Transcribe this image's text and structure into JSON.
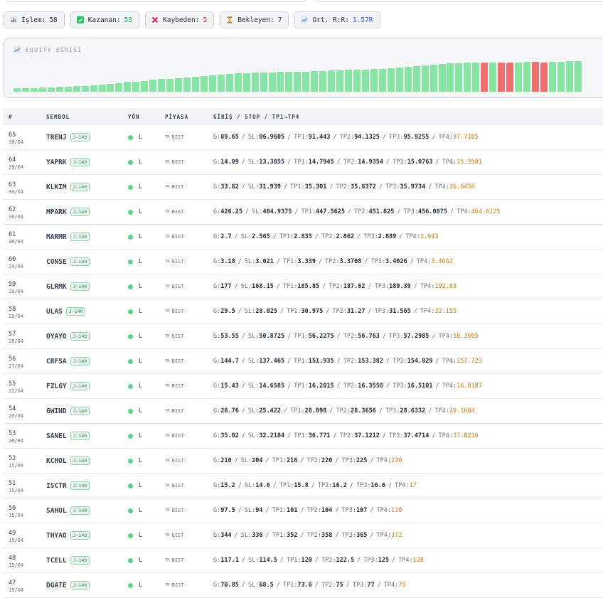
{
  "stats": {
    "islem": {
      "label": "İşlem:",
      "value": "58"
    },
    "kazanan": {
      "label": "Kazanan:",
      "value": "53",
      "color": "#16a34a"
    },
    "kaybeden": {
      "label": "Kaybeden:",
      "value": "5",
      "color": "#dc2626"
    },
    "bekleyen": {
      "label": "Bekleyen:",
      "value": "7"
    },
    "rr": {
      "label": "Ort. R:R:",
      "value": "1.57R",
      "color": "#2563eb"
    }
  },
  "equity": {
    "title": "EQUITY EĞRİSİ",
    "win_color": "#86e5a3",
    "loss_color": "#f07070",
    "bars": [
      {
        "level": 0.1,
        "result": "win"
      },
      {
        "level": 0.11,
        "result": "win"
      },
      {
        "level": 0.12,
        "result": "win"
      },
      {
        "level": 0.13,
        "result": "win"
      },
      {
        "level": 0.14,
        "result": "win"
      },
      {
        "level": 0.15,
        "result": "win"
      },
      {
        "level": 0.16,
        "result": "win"
      },
      {
        "level": 0.17,
        "result": "win"
      },
      {
        "level": 0.18,
        "result": "win"
      },
      {
        "level": 0.2,
        "result": "win"
      },
      {
        "level": 0.22,
        "result": "win"
      },
      {
        "level": 0.25,
        "result": "win"
      },
      {
        "level": 0.27,
        "result": "win"
      },
      {
        "level": 0.3,
        "result": "win"
      },
      {
        "level": 0.32,
        "result": "win"
      },
      {
        "level": 0.34,
        "result": "win"
      },
      {
        "level": 0.37,
        "result": "win"
      },
      {
        "level": 0.39,
        "result": "win"
      },
      {
        "level": 0.41,
        "result": "win"
      },
      {
        "level": 0.43,
        "result": "win"
      },
      {
        "level": 0.45,
        "result": "win"
      },
      {
        "level": 0.47,
        "result": "win"
      },
      {
        "level": 0.49,
        "result": "win"
      },
      {
        "level": 0.51,
        "result": "win"
      },
      {
        "level": 0.53,
        "result": "win"
      },
      {
        "level": 0.55,
        "result": "win"
      },
      {
        "level": 0.57,
        "result": "win"
      },
      {
        "level": 0.58,
        "result": "win"
      },
      {
        "level": 0.59,
        "result": "win"
      },
      {
        "level": 0.6,
        "result": "win"
      },
      {
        "level": 0.61,
        "result": "win"
      },
      {
        "level": 0.62,
        "result": "win"
      },
      {
        "level": 0.62,
        "result": "win"
      },
      {
        "level": 0.63,
        "result": "win"
      },
      {
        "level": 0.63,
        "result": "win"
      },
      {
        "level": 0.64,
        "result": "win"
      },
      {
        "level": 0.65,
        "result": "win"
      },
      {
        "level": 0.66,
        "result": "win"
      },
      {
        "level": 0.67,
        "result": "win"
      },
      {
        "level": 0.68,
        "result": "win"
      },
      {
        "level": 0.69,
        "result": "win"
      },
      {
        "level": 0.7,
        "result": "win"
      },
      {
        "level": 0.71,
        "result": "win"
      },
      {
        "level": 0.72,
        "result": "win"
      },
      {
        "level": 0.74,
        "result": "win"
      },
      {
        "level": 0.76,
        "result": "win"
      },
      {
        "level": 0.78,
        "result": "win"
      },
      {
        "level": 0.8,
        "result": "win"
      },
      {
        "level": 0.82,
        "result": "win"
      },
      {
        "level": 0.84,
        "result": "win"
      },
      {
        "level": 0.86,
        "result": "win"
      },
      {
        "level": 0.88,
        "result": "win"
      },
      {
        "level": 0.89,
        "result": "win"
      },
      {
        "level": 0.9,
        "result": "win"
      },
      {
        "level": 0.91,
        "result": "win"
      },
      {
        "level": 0.92,
        "result": "loss"
      },
      {
        "level": 0.92,
        "result": "win"
      },
      {
        "level": 0.9,
        "result": "loss"
      },
      {
        "level": 0.91,
        "result": "loss"
      },
      {
        "level": 0.92,
        "result": "win"
      },
      {
        "level": 0.93,
        "result": "win"
      },
      {
        "level": 0.93,
        "result": "loss"
      },
      {
        "level": 0.92,
        "result": "loss"
      },
      {
        "level": 0.93,
        "result": "win"
      },
      {
        "level": 0.94,
        "result": "win"
      },
      {
        "level": 0.95,
        "result": "win"
      },
      {
        "level": 0.96,
        "result": "win"
      }
    ]
  },
  "table": {
    "headers": {
      "num": "#",
      "symbol": "SEMBOL",
      "direction": "YÖN",
      "market": "PİYASA",
      "levels": "GİRİŞ / STOP / TP1→TP4"
    },
    "rows": [
      {
        "num": "65",
        "date": "30/04",
        "symbol": "TRENJ",
        "tag": "J-140",
        "dir": "L",
        "flag": "TR",
        "market": "BIST",
        "g": "89.65",
        "sl": "86.9605",
        "tp1": "91.443",
        "tp2": "94.1325",
        "tp3": "95.9255",
        "tp4": "97.7185"
      },
      {
        "num": "64",
        "date": "30/04",
        "symbol": "YAPRK",
        "tag": "J-140",
        "dir": "L",
        "flag": "TR",
        "market": "BIST",
        "g": "14.09",
        "sl": "13.3855",
        "tp1": "14.7945",
        "tp2": "14.9354",
        "tp3": "15.0763",
        "tp4": "15.3581"
      },
      {
        "num": "63",
        "date": "30/04",
        "symbol": "KLKIM",
        "tag": "J-140",
        "dir": "L",
        "flag": "TR",
        "market": "BIST",
        "g": "33.62",
        "sl": "31.939",
        "tp1": "35.301",
        "tp2": "35.6372",
        "tp3": "35.9734",
        "tp4": "36.6458"
      },
      {
        "num": "62",
        "date": "30/04",
        "symbol": "MPARK",
        "tag": "J-140",
        "dir": "L",
        "flag": "TR",
        "market": "BIST",
        "g": "426.25",
        "sl": "404.9375",
        "tp1": "447.5625",
        "tp2": "451.825",
        "tp3": "456.0875",
        "tp4": "464.6125"
      },
      {
        "num": "61",
        "date": "30/04",
        "symbol": "MARMR",
        "tag": "J-140",
        "dir": "L",
        "flag": "TR",
        "market": "BIST",
        "g": "2.7",
        "sl": "2.565",
        "tp1": "2.835",
        "tp2": "2.862",
        "tp3": "2.889",
        "tp4": "2.943"
      },
      {
        "num": "60",
        "date": "29/04",
        "symbol": "CONSE",
        "tag": "J-140",
        "dir": "L",
        "flag": "TR",
        "market": "BIST",
        "g": "3.18",
        "sl": "3.021",
        "tp1": "3.339",
        "tp2": "3.3708",
        "tp3": "3.4026",
        "tp4": "3.4662"
      },
      {
        "num": "59",
        "date": "29/04",
        "symbol": "GLRMK",
        "tag": "J-140",
        "dir": "L",
        "flag": "TR",
        "market": "BIST",
        "g": "177",
        "sl": "168.15",
        "tp1": "185.85",
        "tp2": "187.62",
        "tp3": "189.39",
        "tp4": "192.93"
      },
      {
        "num": "58",
        "date": "29/04",
        "symbol": "ULAS",
        "tag": "J-140",
        "dir": "L",
        "flag": "TR",
        "market": "BIST",
        "g": "29.5",
        "sl": "28.025",
        "tp1": "30.975",
        "tp2": "31.27",
        "tp3": "31.565",
        "tp4": "32.155"
      },
      {
        "num": "57",
        "date": "28/04",
        "symbol": "OYAYO",
        "tag": "J-140",
        "dir": "L",
        "flag": "TR",
        "market": "BIST",
        "g": "53.55",
        "sl": "50.8725",
        "tp1": "56.2275",
        "tp2": "56.763",
        "tp3": "57.2985",
        "tp4": "58.3695"
      },
      {
        "num": "56",
        "date": "27/04",
        "symbol": "CRFSA",
        "tag": "J-140",
        "dir": "L",
        "flag": "TR",
        "market": "BIST",
        "g": "144.7",
        "sl": "137.465",
        "tp1": "151.935",
        "tp2": "153.382",
        "tp3": "154.829",
        "tp4": "157.723"
      },
      {
        "num": "55",
        "date": "22/04",
        "symbol": "FZLGY",
        "tag": "J-140",
        "dir": "L",
        "flag": "TR",
        "market": "BIST",
        "g": "15.43",
        "sl": "14.6585",
        "tp1": "16.2015",
        "tp2": "16.3558",
        "tp3": "16.5101",
        "tp4": "16.8187"
      },
      {
        "num": "54",
        "date": "20/04",
        "symbol": "GWIND",
        "tag": "J-140",
        "dir": "L",
        "flag": "TR",
        "market": "BIST",
        "g": "26.76",
        "sl": "25.422",
        "tp1": "28.098",
        "tp2": "28.3656",
        "tp3": "28.6332",
        "tp4": "29.1684"
      },
      {
        "num": "53",
        "date": "20/04",
        "symbol": "SANEL",
        "tag": "J-140",
        "dir": "L",
        "flag": "TR",
        "market": "BIST",
        "g": "35.02",
        "sl": "32.2184",
        "tp1": "36.771",
        "tp2": "37.1212",
        "tp3": "37.4714",
        "tp4": "37.8216"
      },
      {
        "num": "52",
        "date": "15/04",
        "symbol": "KCHOL",
        "tag": "J-140",
        "dir": "L",
        "flag": "TR",
        "market": "BIST",
        "g": "210",
        "sl": "204",
        "tp1": "216",
        "tp2": "220",
        "tp3": "225",
        "tp4": "230"
      },
      {
        "num": "51",
        "date": "15/04",
        "symbol": "ISCTR",
        "tag": "J-140",
        "dir": "L",
        "flag": "TR",
        "market": "BIST",
        "g": "15.2",
        "sl": "14.6",
        "tp1": "15.8",
        "tp2": "16.2",
        "tp3": "16.6",
        "tp4": "17"
      },
      {
        "num": "50",
        "date": "15/04",
        "symbol": "SAHOL",
        "tag": "J-140",
        "dir": "L",
        "flag": "TR",
        "market": "BIST",
        "g": "97.5",
        "sl": "94",
        "tp1": "101",
        "tp2": "104",
        "tp3": "107",
        "tp4": "110"
      },
      {
        "num": "49",
        "date": "15/04",
        "symbol": "THYAO",
        "tag": "J-140",
        "dir": "L",
        "flag": "TR",
        "market": "BIST",
        "g": "344",
        "sl": "336",
        "tp1": "352",
        "tp2": "358",
        "tp3": "365",
        "tp4": "372"
      },
      {
        "num": "48",
        "date": "15/04",
        "symbol": "TCELL",
        "tag": "J-140",
        "dir": "L",
        "flag": "TR",
        "market": "BIST",
        "g": "117.1",
        "sl": "114.5",
        "tp1": "120",
        "tp2": "122.5",
        "tp3": "125",
        "tp4": "128"
      },
      {
        "num": "47",
        "date": "15/04",
        "symbol": "DGATE",
        "tag": "J-140",
        "dir": "L",
        "flag": "TR",
        "market": "BIST",
        "g": "70.85",
        "sl": "68.5",
        "tp1": "73.6",
        "tp2": "75",
        "tp3": "77",
        "tp4": "79"
      }
    ]
  }
}
